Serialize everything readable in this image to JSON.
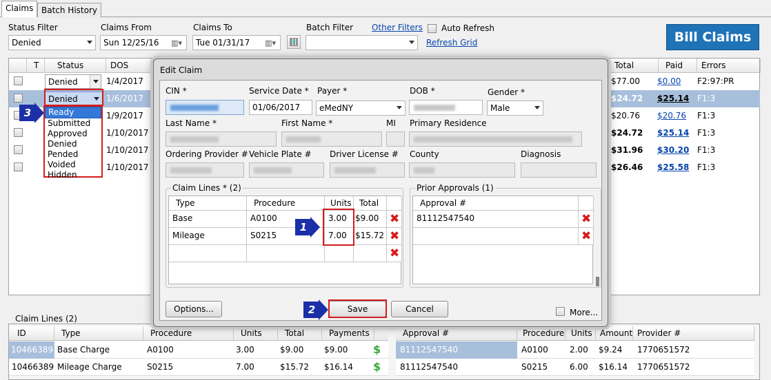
{
  "tabs": [
    "Claims",
    "Batch History"
  ],
  "filters": {
    "status_label": "Status Filter",
    "status_value": "Denied",
    "from_label": "Claims From",
    "from_value": "Sun 12/25/16",
    "to_label": "Claims To",
    "to_value": "Tue 01/31/17",
    "batch_label": "Batch Filter",
    "other_filters": "Other Filters",
    "auto_refresh": "Auto Refresh",
    "refresh_grid": "Refresh Grid",
    "bill_claims": "Bill Claims"
  },
  "grid": {
    "headers": [
      "T",
      "Status",
      "DOS",
      "Total",
      "Paid",
      "Errors"
    ],
    "rows": [
      {
        "status": "Denied",
        "dos": "1/4/2017",
        "total": "$77.00",
        "paid": "$0.00",
        "errors": "F2:97:PR"
      },
      {
        "status": "Denied",
        "dos": "1/6/2017",
        "total": "$24.72",
        "paid": "$25.14",
        "errors": "F1:3"
      },
      {
        "status": "",
        "dos": "1/9/2017",
        "total": "$20.76",
        "paid": "$20.76",
        "errors": "F1:3"
      },
      {
        "status": "",
        "dos": "1/10/2017",
        "total": "$24.72",
        "paid": "$25.14",
        "errors": "F1:3"
      },
      {
        "status": "",
        "dos": "1/10/2017",
        "total": "$31.96",
        "paid": "$30.20",
        "errors": "F1:3"
      },
      {
        "status": "",
        "dos": "1/10/2017",
        "total": "$26.46",
        "paid": "$25.58",
        "errors": "F1:3"
      }
    ]
  },
  "status_options": [
    "Ready",
    "Submitted",
    "Approved",
    "Denied",
    "Pended",
    "Voided",
    "Hidden"
  ],
  "callouts": [
    "1",
    "2",
    "3"
  ],
  "dialog": {
    "title": "Edit Claim",
    "cin_label": "CIN *",
    "service_date_label": "Service Date *",
    "service_date": "01/06/2017",
    "payer_label": "Payer *",
    "payer": "eMedNY",
    "dob_label": "DOB *",
    "gender_label": "Gender *",
    "gender": "Male",
    "last_name_label": "Last Name *",
    "first_name_label": "First Name *",
    "mi_label": "MI",
    "primary_residence_label": "Primary Residence",
    "ordering_provider_label": "Ordering Provider #",
    "vehicle_plate_label": "Vehicle Plate #",
    "driver_license_label": "Driver License #",
    "county_label": "County",
    "diagnosis_label": "Diagnosis",
    "claim_lines_label": "Claim Lines * (2)",
    "claim_headers": [
      "Type",
      "Procedure",
      "Units",
      "Total"
    ],
    "claim_rows": [
      {
        "type": "Base",
        "procedure": "A0100",
        "units": "3.00",
        "total": "$9.00"
      },
      {
        "type": "Mileage",
        "procedure": "S0215",
        "units": "7.00",
        "total": "$15.72"
      }
    ],
    "prior_approvals_label": "Prior Approvals (1)",
    "approval_header": "Approval #",
    "approvals": [
      "81112547540"
    ],
    "options_btn": "Options...",
    "save_btn": "Save",
    "cancel_btn": "Cancel",
    "more_label": "More..."
  },
  "bottom": {
    "claim_lines_label": "Claim Lines (2)",
    "headers": [
      "ID",
      "Type",
      "Procedure",
      "Units",
      "Total",
      "Payments"
    ],
    "rows": [
      {
        "id": "10466389",
        "type": "Base Charge",
        "procedure": "A0100",
        "units": "3.00",
        "total": "$9.00",
        "payments": "$9.00"
      },
      {
        "id": "10466389",
        "type": "Mileage Charge",
        "procedure": "S0215",
        "units": "7.00",
        "total": "$15.72",
        "payments": "$16.14"
      }
    ],
    "right_headers": [
      "Approval #",
      "Procedure",
      "Units",
      "Amount",
      "Provider #"
    ],
    "right_rows": [
      {
        "approval": "81112547540",
        "procedure": "A0100",
        "units": "2.00",
        "amount": "$9.24",
        "provider": "1770651572"
      },
      {
        "approval": "81112547540",
        "procedure": "S0215",
        "units": "6.00",
        "amount": "$16.14",
        "provider": "1770651572"
      }
    ]
  }
}
